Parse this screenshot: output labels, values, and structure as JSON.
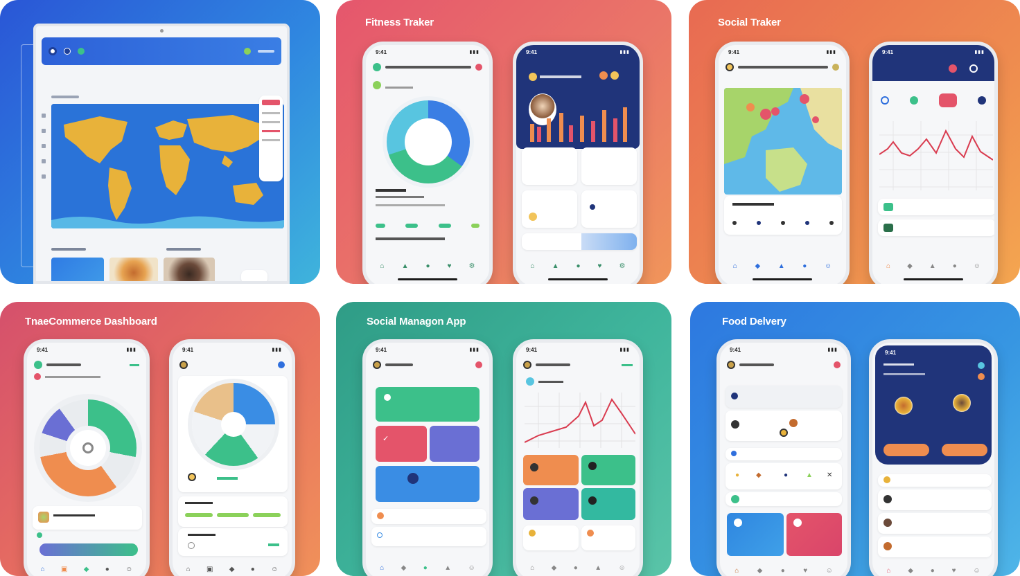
{
  "cards": {
    "fitness": {
      "title": "Fitness Traker"
    },
    "social_tracker": {
      "title": "Social Traker"
    },
    "ecommerce": {
      "title": "TnaeCommerce Dashboard"
    },
    "social_mgmt": {
      "title": "Social Managon App"
    },
    "food": {
      "title": "Food Delvery"
    }
  },
  "statusbar": {
    "time": "9:41"
  },
  "colors": {
    "blue": "#2f6fdd",
    "green": "#3cc08a",
    "red": "#e4546a",
    "orange": "#ef8d4f",
    "navy": "#20347a",
    "purple": "#6a6fd4",
    "teal": "#33b9a0"
  }
}
